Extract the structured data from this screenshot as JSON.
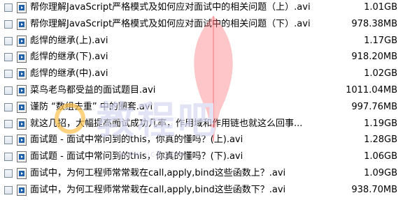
{
  "files": [
    {
      "name": "帮你理解JavaScript严格模式及如何应对面试中的相关问题（上）.avi",
      "size": "1.01GB"
    },
    {
      "name": "帮你理解JavaScript严格模式及如何应对面试中的相关问题（下）.avi",
      "size": "978.38MB"
    },
    {
      "name": "彪悍的继承(上).avi",
      "size": "1.17GB"
    },
    {
      "name": "彪悍的继承(下).avi",
      "size": "918.20MB"
    },
    {
      "name": "彪悍的继承(中).avi",
      "size": "1.02GB"
    },
    {
      "name": "菜鸟老鸟都受益的面试题目.avi",
      "size": "1011.04MB"
    },
    {
      "name": "谨防 “数组去重” 中的圈套.avi",
      "size": "997.76MB"
    },
    {
      "name": "就这几招，大幅提高面试成功几率，作用域和作用链也就这么回事...",
      "size": "1.19GB"
    },
    {
      "name": "面试题 - 面试中常问到的this，你真的懂吗？(上).avi",
      "size": "1.28GB"
    },
    {
      "name": "面试题 - 面试中常问到的this，你真的懂吗？(下).avi",
      "size": "1.06GB"
    },
    {
      "name": "面试中，为何工程师常常栽在call,apply,bind这些函数上？.avi",
      "size": "1.09GB"
    },
    {
      "name": "面试中，为何工程师常常栽在call,apply,bind这些函数下？.avi",
      "size": "938.70MB"
    }
  ],
  "watermark": {
    "text": "教程吧",
    "site": "www.ijc8.com",
    "color": "#ff4d5a"
  }
}
